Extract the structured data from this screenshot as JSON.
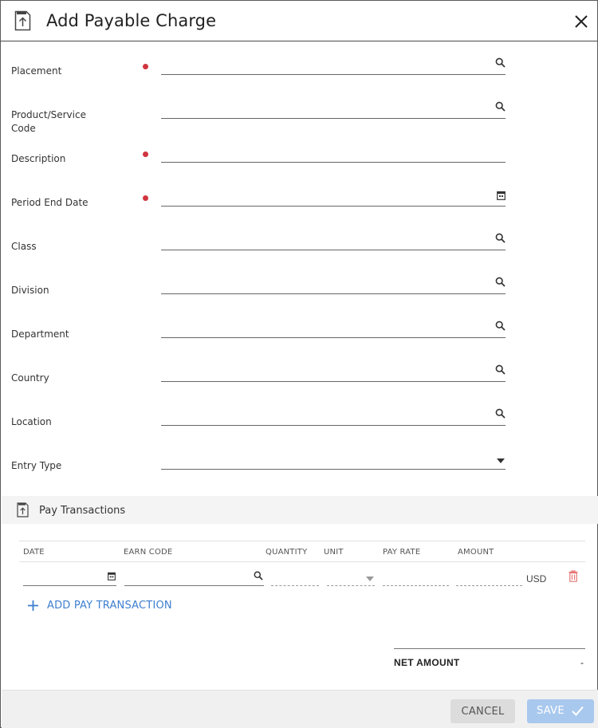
{
  "dialog": {
    "title": "Add Payable Charge",
    "close_icon": "close-icon",
    "header_icon": "document-upload-icon"
  },
  "form": {
    "fields": [
      {
        "label": "Placement",
        "required": true,
        "icon": "search-icon",
        "value": ""
      },
      {
        "label": "Product/Service Code",
        "required": false,
        "icon": "search-icon",
        "value": ""
      },
      {
        "label": "Description",
        "required": true,
        "icon": "",
        "value": ""
      },
      {
        "label": "Period End Date",
        "required": true,
        "icon": "calendar-icon",
        "value": ""
      },
      {
        "label": "Class",
        "required": false,
        "icon": "search-icon",
        "value": ""
      },
      {
        "label": "Division",
        "required": false,
        "icon": "search-icon",
        "value": ""
      },
      {
        "label": "Department",
        "required": false,
        "icon": "search-icon",
        "value": ""
      },
      {
        "label": "Country",
        "required": false,
        "icon": "search-icon",
        "value": ""
      },
      {
        "label": "Location",
        "required": false,
        "icon": "search-icon",
        "value": ""
      },
      {
        "label": "Entry Type",
        "required": false,
        "icon": "dropdown-arrow-icon",
        "value": ""
      }
    ],
    "required_color": "#d0353f"
  },
  "pay_transactions": {
    "section_title": "Pay Transactions",
    "columns": [
      "DATE",
      "EARN CODE",
      "QUANTITY",
      "UNIT",
      "PAY RATE",
      "AMOUNT"
    ],
    "row": {
      "date": "",
      "earn_code": "",
      "quantity": "",
      "unit": "",
      "pay_rate": "",
      "amount": "",
      "currency": "USD"
    },
    "add_label": "ADD PAY TRANSACTION"
  },
  "summary": {
    "net_amount_label": "NET AMOUNT",
    "net_amount_value": "-"
  },
  "footer": {
    "cancel_label": "CANCEL",
    "save_label": "SAVE"
  },
  "colors": {
    "accent": "#3d7fcf",
    "save_disabled": "#a9c8ee",
    "delete_icon": "#e57373"
  }
}
